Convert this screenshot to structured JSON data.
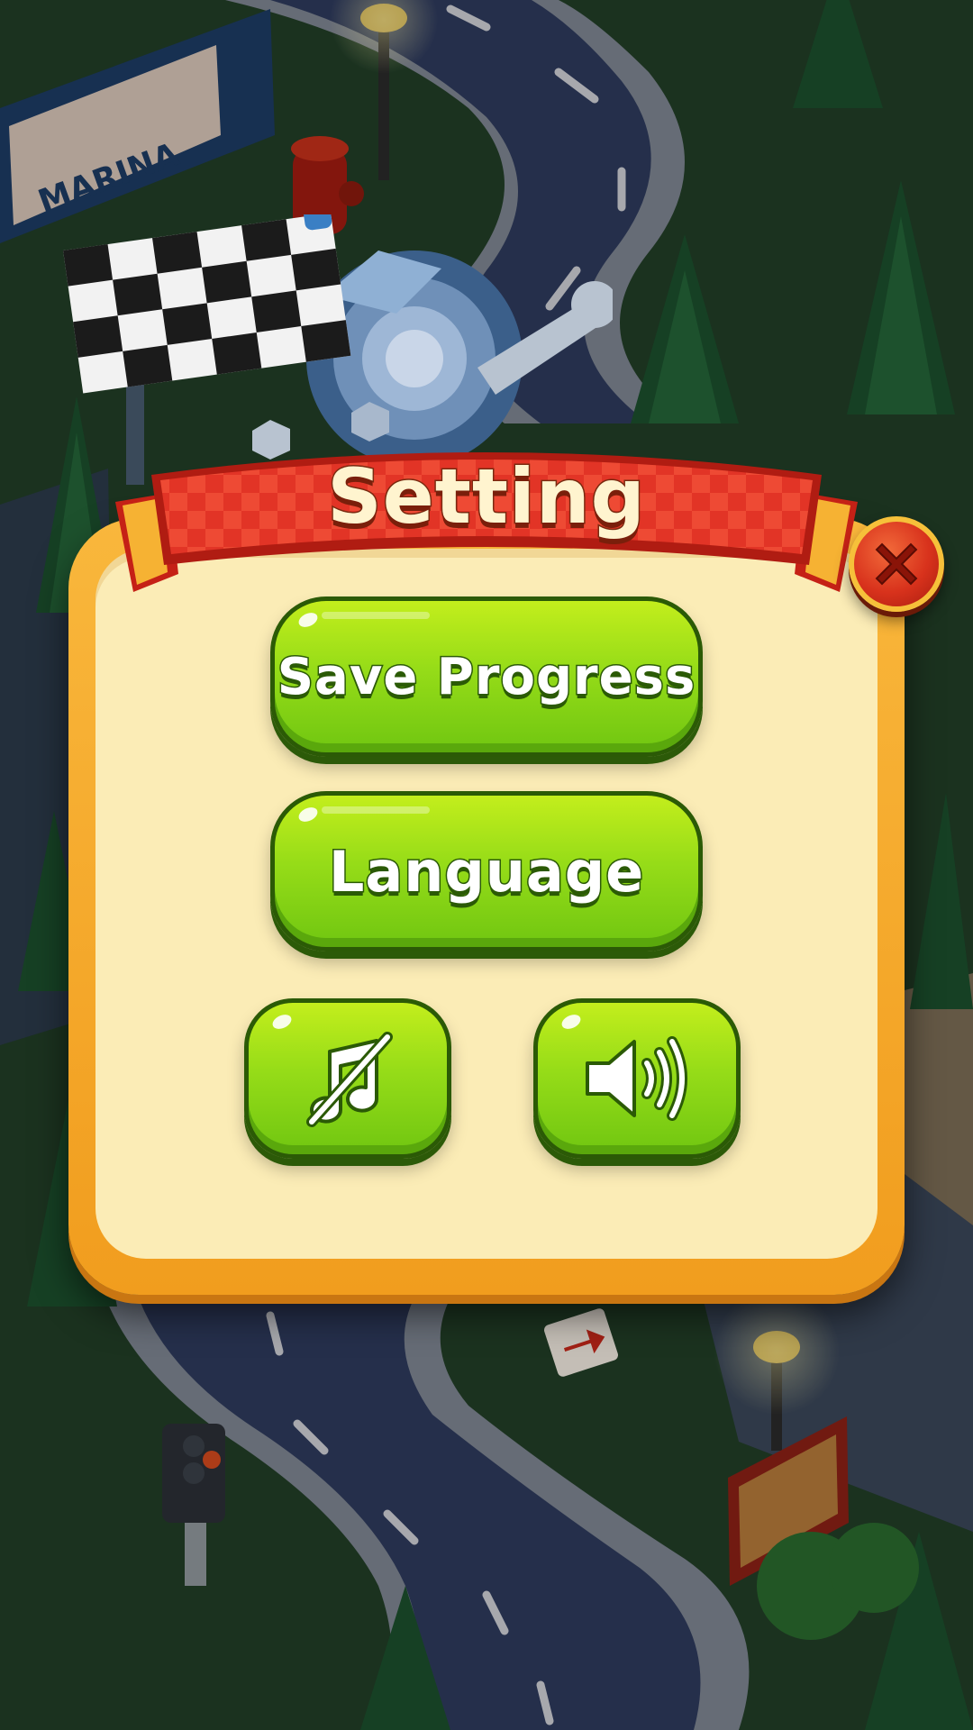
{
  "background": {
    "billboard_text": "MARINA"
  },
  "dialog": {
    "title": "Setting",
    "close_icon": "close-x-icon",
    "buttons": {
      "save_progress": "Save Progress",
      "language": "Language",
      "music_icon": "music-off-icon",
      "sound_icon": "speaker-on-icon"
    }
  },
  "colors": {
    "ribbon": "#e8322a",
    "panel": "#fbecb6",
    "panel_border": "#f5a925",
    "button_green": "#8cd417",
    "close_red": "#d8321c"
  }
}
